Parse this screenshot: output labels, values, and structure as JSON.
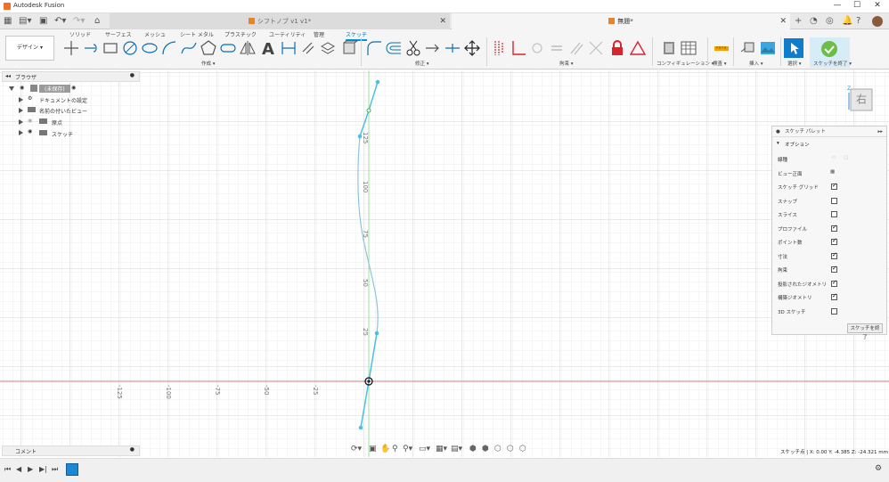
{
  "app": {
    "title": "Autodesk Fusion",
    "window_controls": [
      "—",
      "☐",
      "✕"
    ]
  },
  "tabs": [
    {
      "label": "シフトノブ v1 v1*",
      "active": false
    },
    {
      "label": "無題*",
      "active": true
    }
  ],
  "ribbon": {
    "tabs": [
      "ソリッド",
      "サーフェス",
      "メッシュ",
      "シート メタル",
      "プラスチック",
      "ユーティリティ",
      "管理",
      "スケッチ"
    ],
    "active_tab": "スケッチ",
    "design_button": "デザイン ▾",
    "groups": {
      "create": "作成 ▾",
      "modify": "修正 ▾",
      "constraints": "拘束 ▾",
      "configure": "コンフィギュレーション ▾",
      "inspect": "検査 ▾",
      "insert": "挿入 ▾",
      "select": "選択 ▾",
      "finish": "スケッチを終了 ▾"
    }
  },
  "browser": {
    "title": "ブラウザ",
    "root": "(未保存)",
    "items": [
      "ドキュメントの設定",
      "名前の付いたビュー",
      "原点",
      "スケッチ"
    ]
  },
  "comments": {
    "label": "コメント"
  },
  "sketch_palette": {
    "title": "スケッチ パレット",
    "section": "オプション",
    "options": [
      {
        "label": "線種",
        "type": "icons"
      },
      {
        "label": "ビュー正面",
        "type": "button"
      },
      {
        "label": "スケッチ グリッド",
        "checked": true
      },
      {
        "label": "スナップ",
        "checked": false
      },
      {
        "label": "スライス",
        "checked": false
      },
      {
        "label": "プロファイル",
        "checked": true
      },
      {
        "label": "ポイント数",
        "checked": true
      },
      {
        "label": "寸法",
        "checked": true
      },
      {
        "label": "拘束",
        "checked": true
      },
      {
        "label": "投影されたジオメトリ",
        "checked": true
      },
      {
        "label": "構築ジオメトリ",
        "checked": true
      },
      {
        "label": "3D スケッチ",
        "checked": false
      }
    ],
    "finish": "スケッチを終了"
  },
  "canvas": {
    "vertical_ticks": [
      "125",
      "100",
      "75",
      "50",
      "25"
    ],
    "horizontal_ticks": [
      "-125",
      "-100",
      "-75",
      "-50",
      "-25"
    ]
  },
  "viewcube": {
    "face": "右",
    "axis": "Z"
  },
  "status": {
    "text": "スケッチ点 | X: 0.00 Y: -4.385 Z: -24.321 mm"
  }
}
